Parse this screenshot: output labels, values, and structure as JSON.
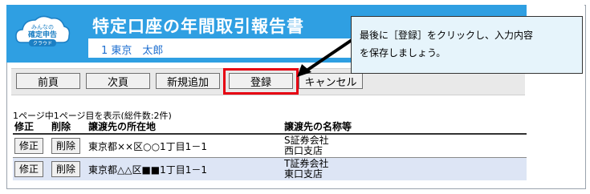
{
  "logo": {
    "line1": "みんなの",
    "line2": "確定申告",
    "line3": "クラウド"
  },
  "header": {
    "title": "特定口座の年間取引報告書",
    "user": "1 東京　太郎"
  },
  "toolbar": {
    "prev": "前頁",
    "next": "次頁",
    "add": "新規追加",
    "register": "登録",
    "cancel": "キャンセル"
  },
  "callout": {
    "line1": "最後に［登録］をクリックし、入力内容",
    "line2": "を保存しましょう。"
  },
  "list": {
    "count_text": "1ページ中1ページ目を表示(総件数:2件)",
    "headers": {
      "edit": "修正",
      "delete": "削除",
      "address": "譲渡先の所在地",
      "name": "譲渡先の名称等"
    },
    "rows": [
      {
        "edit": "修正",
        "delete": "削除",
        "address": "東京都××区○○1丁目1－1",
        "name1": "S証券会社",
        "name2": "西口支店"
      },
      {
        "edit": "修正",
        "delete": "削除",
        "address": "東京都△△区■■1丁目1－1",
        "name1": "T証券会社",
        "name2": "東口支店"
      }
    ]
  },
  "colors": {
    "header_bg": "#2f9fe2",
    "highlight": "#e60012",
    "callout_bg": "#e6f4fb",
    "row_alt": "#dde5f5"
  }
}
